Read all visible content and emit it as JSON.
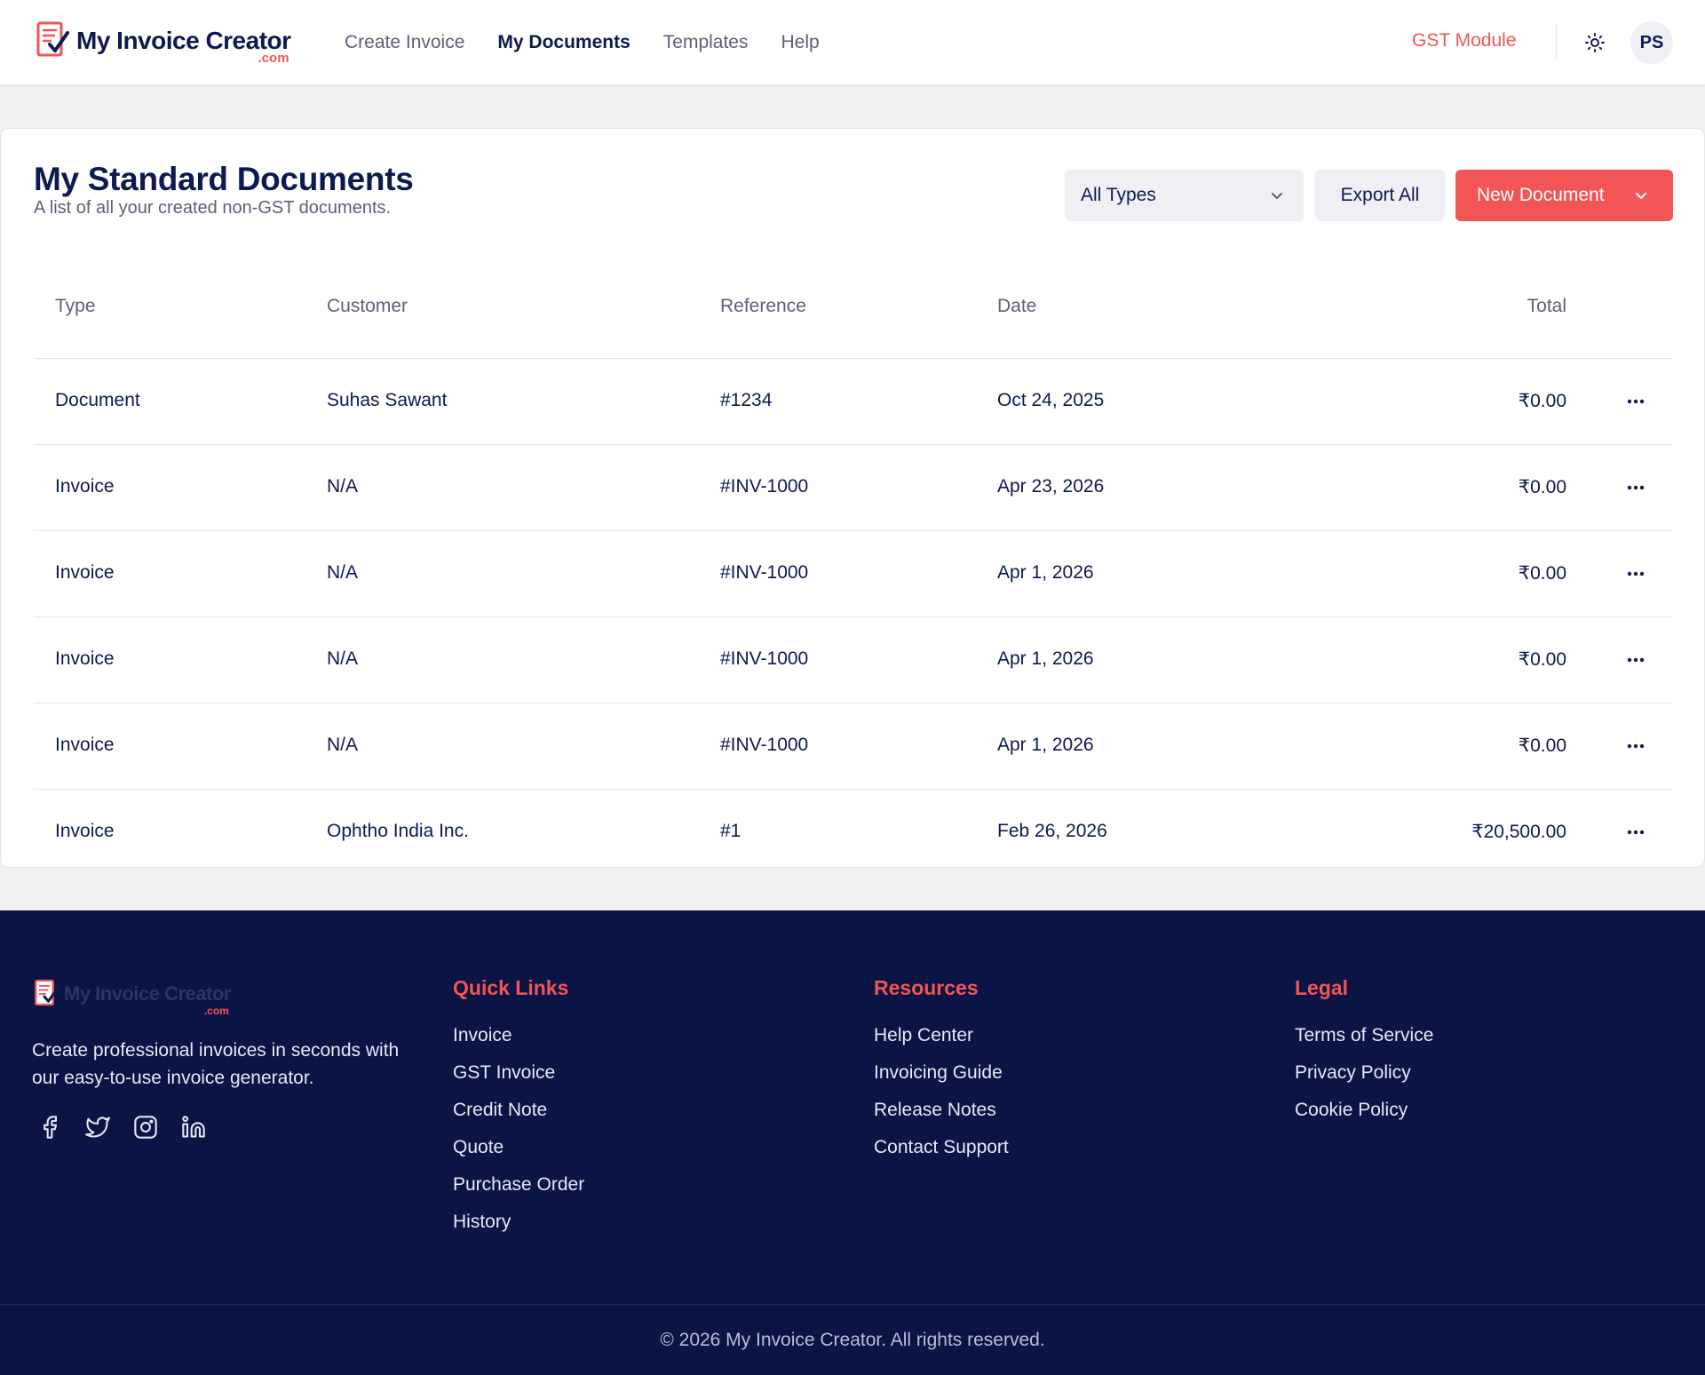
{
  "brand": {
    "name": "My Invoice Creator",
    "suffix": ".com"
  },
  "nav": [
    {
      "label": "Create Invoice",
      "active": false
    },
    {
      "label": "My Documents",
      "active": true
    },
    {
      "label": "Templates",
      "active": false
    },
    {
      "label": "Help",
      "active": false
    }
  ],
  "header": {
    "gst_link": "GST Module",
    "theme_icon": "sun-icon",
    "avatar_initials": "PS"
  },
  "page": {
    "title": "My Standard Documents",
    "subtitle": "A list of all your created non-GST documents.",
    "filter_value": "All Types",
    "export_label": "Export All",
    "new_label": "New Document"
  },
  "table": {
    "columns": {
      "type": "Type",
      "customer": "Customer",
      "reference": "Reference",
      "date": "Date",
      "total": "Total"
    },
    "rows": [
      {
        "type": "Document",
        "customer": "Suhas Sawant",
        "reference": "#1234",
        "date": "Oct 24, 2025",
        "total": "₹0.00"
      },
      {
        "type": "Invoice",
        "customer": "N/A",
        "reference": "#INV-1000",
        "date": "Apr 23, 2026",
        "total": "₹0.00"
      },
      {
        "type": "Invoice",
        "customer": "N/A",
        "reference": "#INV-1000",
        "date": "Apr 1, 2026",
        "total": "₹0.00"
      },
      {
        "type": "Invoice",
        "customer": "N/A",
        "reference": "#INV-1000",
        "date": "Apr 1, 2026",
        "total": "₹0.00"
      },
      {
        "type": "Invoice",
        "customer": "N/A",
        "reference": "#INV-1000",
        "date": "Apr 1, 2026",
        "total": "₹0.00"
      },
      {
        "type": "Invoice",
        "customer": "Ophtho India Inc.",
        "reference": "#1",
        "date": "Feb 26, 2026",
        "total": "₹20,500.00"
      }
    ]
  },
  "footer": {
    "description": "Create professional invoices in seconds with our easy-to-use invoice generator.",
    "socials": [
      "facebook-icon",
      "twitter-icon",
      "instagram-icon",
      "linkedin-icon"
    ],
    "quick_links": {
      "heading": "Quick Links",
      "items": [
        "Invoice",
        "GST Invoice",
        "Credit Note",
        "Quote",
        "Purchase Order",
        "History"
      ]
    },
    "resources": {
      "heading": "Resources",
      "items": [
        "Help Center",
        "Invoicing Guide",
        "Release Notes",
        "Contact Support"
      ]
    },
    "legal": {
      "heading": "Legal",
      "items": [
        "Terms of Service",
        "Privacy Policy",
        "Cookie Policy"
      ]
    },
    "copyright": "© 2026 My Invoice Creator. All rights reserved."
  },
  "colors": {
    "navy": "#0d1a4f",
    "accent": "#f25555",
    "footer_bg": "#0a1445",
    "muted": "#5b6276"
  }
}
